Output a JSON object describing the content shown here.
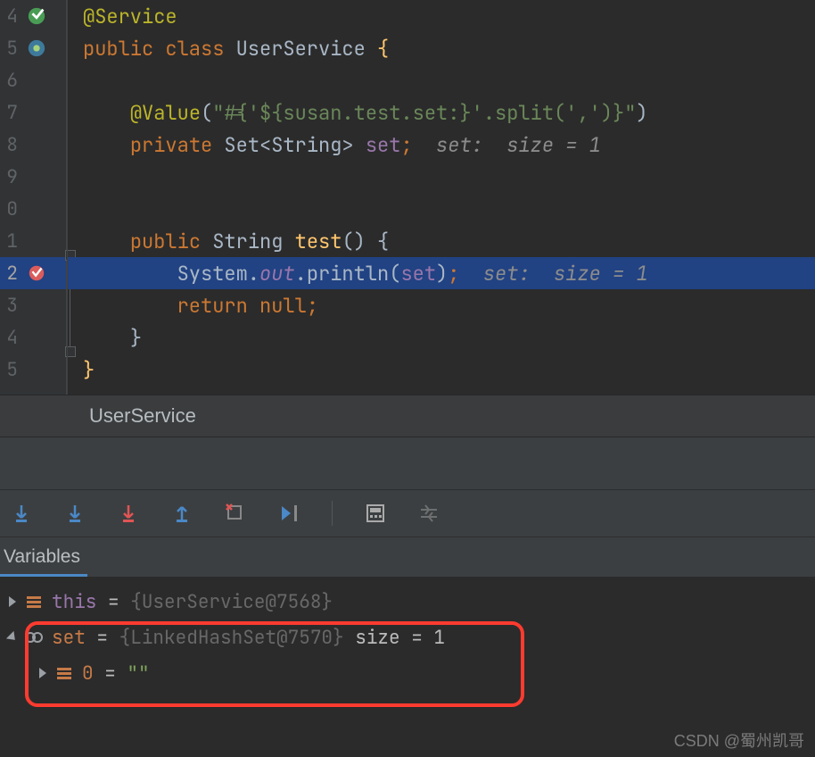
{
  "editor": {
    "lines": [
      {
        "num": "4"
      },
      {
        "num": "5"
      },
      {
        "num": "6"
      },
      {
        "num": "7"
      },
      {
        "num": "8"
      },
      {
        "num": "9"
      },
      {
        "num": "0"
      },
      {
        "num": "1"
      },
      {
        "num": "2"
      },
      {
        "num": "3"
      },
      {
        "num": "4"
      },
      {
        "num": "5"
      }
    ],
    "code": {
      "l4_ann": "@Service",
      "l5_kw1": "public ",
      "l5_kw2": "class ",
      "l5_cls": "UserService ",
      "l5_brace": "{",
      "l7_ann": "@Value",
      "l7_par1": "(",
      "l7_str": "\"#{'${susan.test.set:}'.split(',')}\"",
      "l7_par2": ")",
      "l8_kw": "private ",
      "l8_type": "Set<String> ",
      "l8_field": "set",
      "l8_semi": ";",
      "l8_hint": "  set:  size = 1",
      "l11_kw": "public ",
      "l11_type": "String ",
      "l11_fn": "test",
      "l11_par": "() ",
      "l11_brace": "{",
      "l12_sys": "System.",
      "l12_out": "out",
      "l12_dot": ".",
      "l12_println": "println",
      "l12_p1": "(",
      "l12_arg": "set",
      "l12_p2": ")",
      "l12_semi": ";",
      "l12_hint": "  set:  size = 1",
      "l13_kw": "return ",
      "l13_null": "null",
      "l13_semi": ";",
      "l14_brace": "}",
      "l15_brace": "}"
    }
  },
  "breadcrumb": "UserService",
  "vars": {
    "header": "Variables",
    "rows": {
      "r0_name": "this",
      "r0_eq": " = ",
      "r0_obj": "{UserService@7568}",
      "r1_name": "set",
      "r1_eq": " = ",
      "r1_obj": "{LinkedHashSet@7570}",
      "r1_sp": "  ",
      "r1_size": "size = 1",
      "r2_name": "0",
      "r2_eq": " = ",
      "r2_val": "\"\""
    }
  },
  "watermark": "CSDN @蜀州凯哥"
}
